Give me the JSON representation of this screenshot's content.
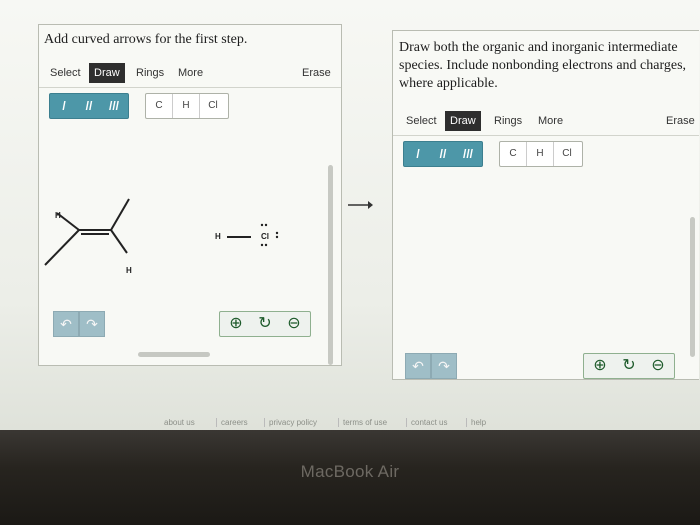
{
  "left_panel": {
    "prompt": "Add curved arrows for the first step.",
    "toolbar": {
      "select": "Select",
      "draw": "Draw",
      "rings": "Rings",
      "more": "More",
      "erase": "Erase"
    },
    "bond_buttons": [
      "/",
      "//",
      "///"
    ],
    "atom_buttons": [
      "C",
      "H",
      "Cl"
    ],
    "molecule_labels": {
      "h_top_left": "H",
      "h_bottom": "H",
      "hcl_h": "H",
      "hcl_cl": "Cl"
    }
  },
  "right_panel": {
    "prompt": "Draw both the organic and inorganic intermediate species. Include nonbonding electrons and charges, where applicable.",
    "toolbar": {
      "select": "Select",
      "draw": "Draw",
      "rings": "Rings",
      "more": "More",
      "erase": "Erase"
    },
    "bond_buttons": [
      "/",
      "//",
      "///"
    ],
    "atom_buttons": [
      "C",
      "H",
      "Cl"
    ]
  },
  "reaction_arrow": "→",
  "footer": {
    "links": [
      "about us",
      "careers",
      "privacy policy",
      "terms of use",
      "contact us",
      "help"
    ]
  },
  "device_label": "MacBook Air",
  "icons": {
    "undo": "undo-icon",
    "redo": "redo-icon",
    "zoom_in": "zoom-in-icon",
    "zoom_reset": "zoom-reset-icon",
    "zoom_out": "zoom-out-icon"
  },
  "colors": {
    "bond_button": "#4d97a8",
    "active_tab": "#2e2e2e",
    "zoom_icon": "#1d5a2a"
  }
}
